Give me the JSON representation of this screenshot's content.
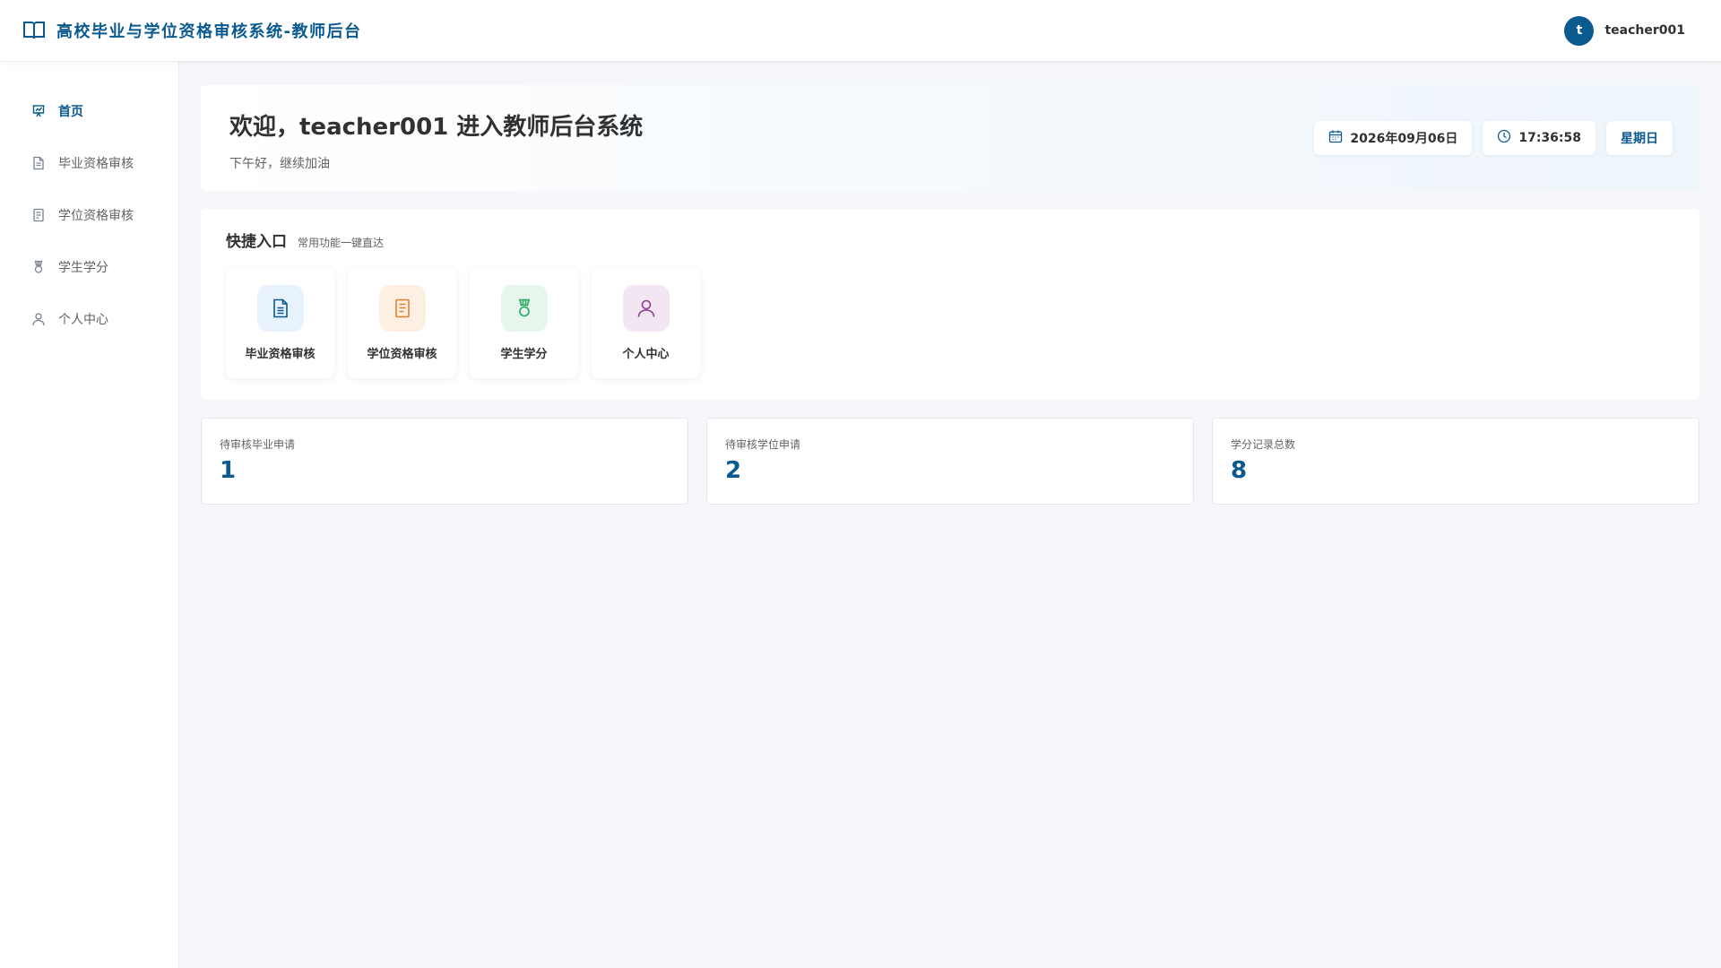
{
  "header": {
    "title": "高校毕业与学位资格审核系统-教师后台",
    "avatar_letter": "t",
    "username": "teacher001"
  },
  "sidebar": {
    "items": [
      {
        "label": "首页",
        "icon": "presentation-chart-icon",
        "active": true
      },
      {
        "label": "毕业资格审核",
        "icon": "document-icon",
        "active": false
      },
      {
        "label": "学位资格审核",
        "icon": "document-list-icon",
        "active": false
      },
      {
        "label": "学生学分",
        "icon": "medal-icon",
        "active": false
      },
      {
        "label": "个人中心",
        "icon": "user-icon",
        "active": false
      }
    ]
  },
  "welcome": {
    "title": "欢迎，teacher001 进入教师后台系统",
    "subtitle": "下午好，继续加油",
    "date": "2026年09月06日",
    "time": "17:36:58",
    "weekday": "星期日"
  },
  "quick": {
    "title": "快捷入口",
    "subtitle": "常用功能一键直达",
    "cards": [
      {
        "label": "毕业资格审核",
        "icon": "document-icon",
        "bg": "#e8f2fc",
        "color": "#0b5a8f"
      },
      {
        "label": "学位资格审核",
        "icon": "document-list-icon",
        "bg": "#fdf0e3",
        "color": "#e6812e"
      },
      {
        "label": "学生学分",
        "icon": "medal-icon",
        "bg": "#e6f6ec",
        "color": "#22a85a"
      },
      {
        "label": "个人中心",
        "icon": "user-icon",
        "bg": "#f3e6f3",
        "color": "#8e3d93"
      }
    ]
  },
  "stats": [
    {
      "label": "待审核毕业申请",
      "value": "1"
    },
    {
      "label": "待审核学位申请",
      "value": "2"
    },
    {
      "label": "学分记录总数",
      "value": "8"
    }
  ],
  "colors": {
    "primary": "#0b5a8f",
    "background": "#f5f7fa"
  }
}
